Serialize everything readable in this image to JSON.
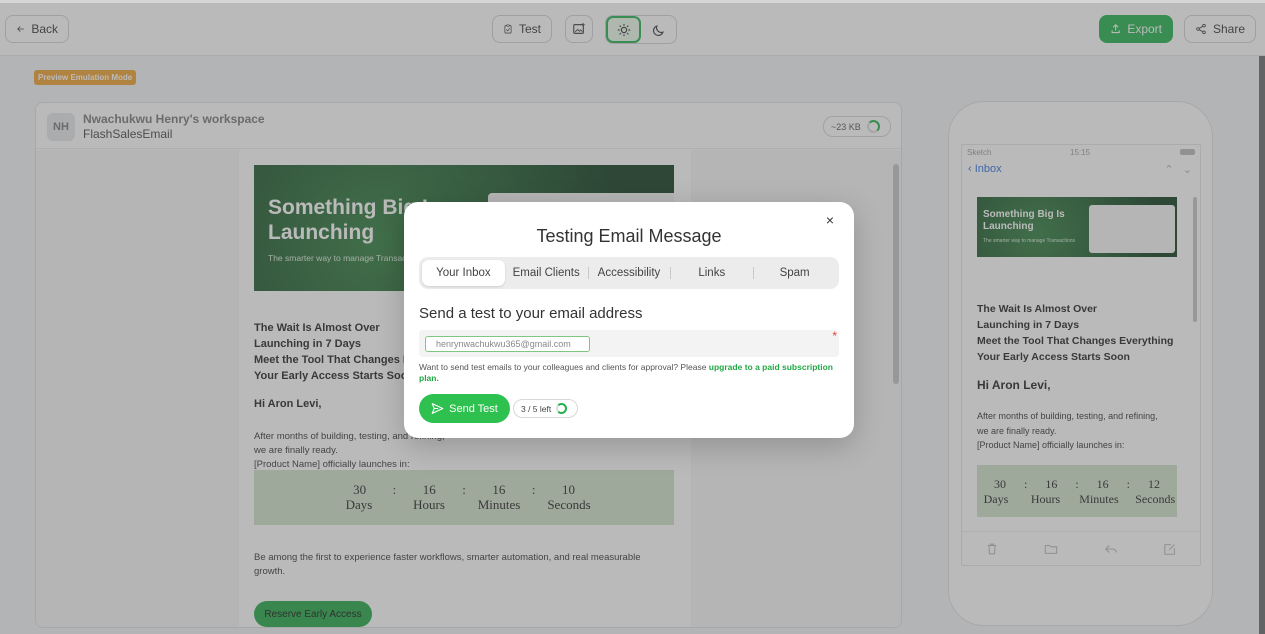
{
  "topbar": {
    "back_label": "Back",
    "test_label": "Test",
    "export_label": "Export",
    "share_label": "Share",
    "icons": [
      "arrow-left-icon",
      "clipboard-check-icon",
      "image-plus-icon",
      "sun-icon",
      "moon-icon",
      "export-icon",
      "share-icon"
    ]
  },
  "preview_badge": "Preview Emulation Mode",
  "workspace": {
    "avatar": "NH",
    "name": "Nwachukwu Henry's workspace",
    "email_name": "FlashSalesEmail",
    "size": "~23 KB"
  },
  "email": {
    "hero_title": "Something Big Is Launching",
    "hero_subtitle": "The smarter way to manage Transactions",
    "headline": "The Wait Is Almost Over\nLaunching in 7 Days\nMeet the Tool That Changes Everything\nYour Early Access Starts Soon",
    "greeting": "Hi Aron Levi,",
    "body": "After months of building, testing, and refining, we are finally ready.\n[Product Name] officially launches in:",
    "countdown": {
      "days": "30",
      "hours": "16",
      "minutes": "16",
      "seconds": "10",
      "days_label": "Days",
      "hours_label": "Hours",
      "minutes_label": "Minutes",
      "seconds_label": "Seconds",
      "sep": ":"
    },
    "paragraph": "Be among the first to experience faster workflows, smarter automation, and real measurable growth.",
    "cta": "Reserve Early Access"
  },
  "phone": {
    "carrier": "Sketch",
    "time": "15:15",
    "back_label": "Inbox",
    "hero_title": "Something Big Is Launching",
    "hero_subtitle": "The smarter way to manage Transactions",
    "headline": "The Wait Is Almost Over\nLaunching in 7 Days\nMeet the Tool That Changes Everything\nYour Early Access Starts Soon",
    "greeting": "Hi Aron Levi,",
    "body": "After months of building, testing, and refining,\nwe are finally ready.\n[Product Name] officially launches in:",
    "countdown": {
      "days": "30",
      "hours": "16",
      "minutes": "16",
      "seconds": "12",
      "days_label": "Days",
      "hours_label": "Hours",
      "minutes_label": "Minutes",
      "seconds_label": "Seconds",
      "sep": ":"
    },
    "toolbar_icons": [
      "trash-icon",
      "folder-icon",
      "reply-icon",
      "compose-icon"
    ]
  },
  "modal": {
    "title": "Testing Email Message",
    "close": "×",
    "tabs": [
      "Your Inbox",
      "Email Clients",
      "Accessibility",
      "Links",
      "Spam"
    ],
    "active_tab": "Your Inbox",
    "heading": "Send a test to your email address",
    "email_value": "henrynwachukwu365@gmail.com",
    "required_mark": "*",
    "help_text": "Want to send test emails to your colleagues and clients for approval? Please ",
    "help_link": "upgrade to a paid subscription plan.",
    "send_label": "Send Test",
    "remaining": "3 / 5 left"
  },
  "colors": {
    "accent": "#22b14c",
    "badge": "#f0a030",
    "countdown_bg": "#cfe2cc",
    "required": "#e04a2f",
    "link": "#2a6fdb"
  }
}
